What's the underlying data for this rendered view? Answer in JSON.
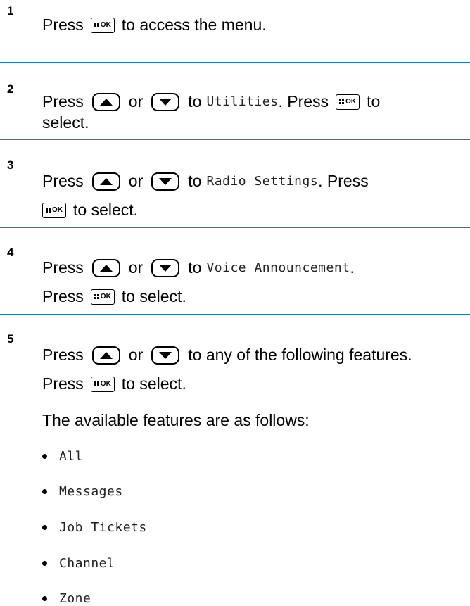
{
  "steps": [
    {
      "num": "1",
      "lines": [
        [
          "Press",
          "to access the menu."
        ]
      ]
    },
    {
      "num": "2",
      "l1_a": "Press",
      "l1_or": "or",
      "l1_to": "to",
      "l1_menu": "Utilities",
      "l1_press": ". Press",
      "l1_end": "to",
      "l2": "select."
    },
    {
      "num": "3",
      "l1_a": "Press",
      "l1_or": "or",
      "l1_to": "to",
      "l1_menu": "Radio Settings",
      "l1_press": ". Press",
      "l2": "to select."
    },
    {
      "num": "4",
      "l1_a": "Press",
      "l1_or": "or",
      "l1_to": "to",
      "l1_menu": "Voice Announcement",
      "l1_end": ".",
      "l2_a": "Press",
      "l2_b": "to select."
    },
    {
      "num": "5",
      "l1_a": "Press",
      "l1_or": "or",
      "l1_to": "to any of the following features.",
      "l2_a": "Press",
      "l2_b": "to select.",
      "intro": "The available features are as follows:",
      "features": [
        "All",
        "Messages",
        "Job Tickets",
        "Channel",
        "Zone"
      ]
    }
  ],
  "icons": {
    "ok_label": "OK",
    "up": "arrow-up-icon",
    "down": "arrow-down-icon",
    "menu_ok": "menu-ok-button-icon"
  },
  "colors": {
    "divider": "#2f6fae"
  }
}
